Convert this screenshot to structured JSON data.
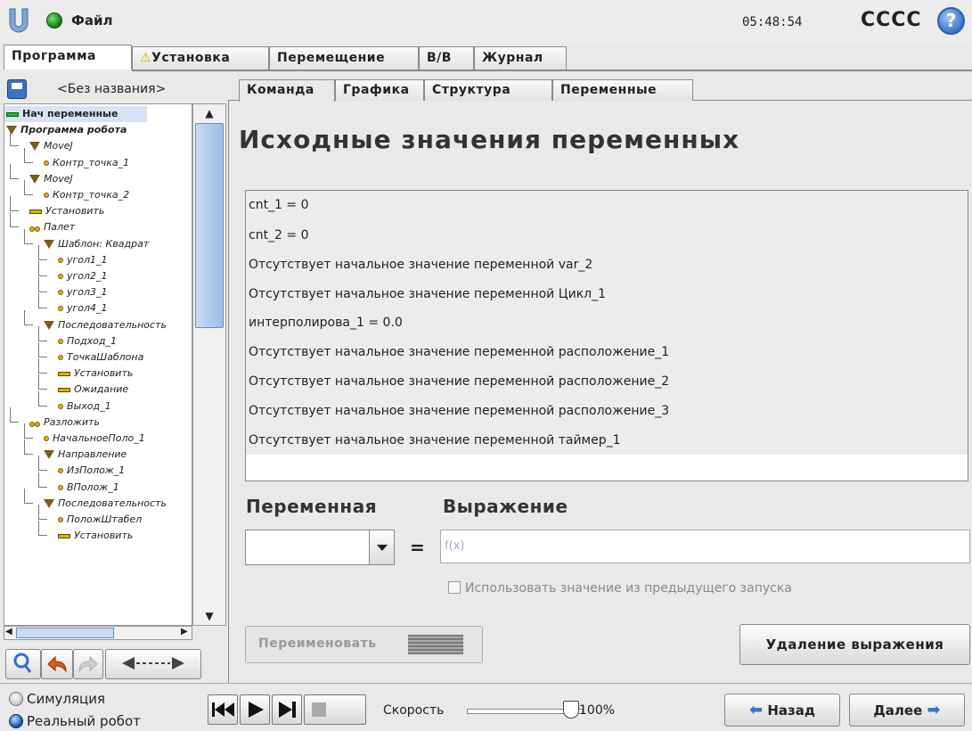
{
  "header": {
    "file_menu": "Файл",
    "clock": "05:48:54",
    "robot_name": "CCCC",
    "help": "?"
  },
  "main_tabs": [
    {
      "label": "Программа",
      "active": true
    },
    {
      "label": "Установка",
      "warning": true
    },
    {
      "label": "Перемещение"
    },
    {
      "label": "В/В"
    },
    {
      "label": "Журнал"
    }
  ],
  "program": {
    "name": "<Без названия>"
  },
  "tree": [
    {
      "label": "Нач переменные",
      "icon": "green-bar",
      "depth": 0,
      "highlight": true
    },
    {
      "label": "Программа робота",
      "icon": "triangle",
      "depth": 0,
      "bold": true
    },
    {
      "label": "MoveJ",
      "icon": "triangle",
      "depth": 1
    },
    {
      "label": "Контр_точка_1",
      "icon": "waypoint",
      "depth": 2
    },
    {
      "label": "MoveJ",
      "icon": "triangle",
      "depth": 1
    },
    {
      "label": "Контр_точка_2",
      "icon": "waypoint",
      "depth": 2
    },
    {
      "label": "Установить",
      "icon": "bar",
      "depth": 1
    },
    {
      "label": "Палет",
      "icon": "pallet",
      "depth": 1
    },
    {
      "label": "Шаблон: Квадрат",
      "icon": "triangle",
      "depth": 2
    },
    {
      "label": "угол1_1",
      "icon": "waypoint",
      "depth": 3
    },
    {
      "label": "угол2_1",
      "icon": "waypoint",
      "depth": 3
    },
    {
      "label": "угол3_1",
      "icon": "waypoint",
      "depth": 3
    },
    {
      "label": "угол4_1",
      "icon": "waypoint",
      "depth": 3
    },
    {
      "label": "Последовательность",
      "icon": "triangle",
      "depth": 2
    },
    {
      "label": "Подход_1",
      "icon": "waypoint",
      "depth": 3
    },
    {
      "label": "ТочкаШаблона",
      "icon": "waypoint",
      "depth": 3
    },
    {
      "label": "Установить",
      "icon": "bar",
      "depth": 3
    },
    {
      "label": "Ожидание",
      "icon": "bar",
      "depth": 3
    },
    {
      "label": "Выход_1",
      "icon": "waypoint",
      "depth": 3
    },
    {
      "label": "Разложить",
      "icon": "pallet",
      "depth": 1
    },
    {
      "label": "НачальноеПоло_1",
      "icon": "waypoint",
      "depth": 2
    },
    {
      "label": "Направление",
      "icon": "triangle",
      "depth": 2
    },
    {
      "label": "ИзПолож_1",
      "icon": "waypoint",
      "depth": 3
    },
    {
      "label": "ВПолож_1",
      "icon": "waypoint",
      "depth": 3
    },
    {
      "label": "Последовательность",
      "icon": "triangle",
      "depth": 2
    },
    {
      "label": "ПоложШтабел",
      "icon": "waypoint",
      "depth": 3
    },
    {
      "label": "Установить",
      "icon": "bar",
      "depth": 3
    }
  ],
  "sub_tabs": [
    {
      "label": "Команда",
      "active": true
    },
    {
      "label": "Графика"
    },
    {
      "label": "Структура"
    },
    {
      "label": "Переменные"
    }
  ],
  "page": {
    "title": "Исходные значения переменных",
    "variables": [
      "cnt_1 = 0",
      "cnt_2 = 0",
      "Отсутствует начальное значение переменной var_2",
      "Отсутствует начальное значение переменной Цикл_1",
      "интерполирова_1 = 0.0",
      "Отсутствует начальное значение переменной расположение_1",
      "Отсутствует начальное значение переменной расположение_2",
      "Отсутствует начальное значение переменной расположение_3",
      "Отсутствует начальное значение переменной таймер_1"
    ],
    "variable_label": "Переменная",
    "expression_label": "Выражение",
    "equals": "=",
    "expression_placeholder": "f(x)",
    "use_previous_label": "Использовать значение из предыдущего запуска",
    "use_previous_checked": false,
    "rename_button": "Переименовать",
    "delete_button": "Удаление выражения"
  },
  "footer": {
    "simulation_label": "Симуляция",
    "real_robot_label": "Реальный робот",
    "real_robot_selected": true,
    "speed_label": "Скорость",
    "speed_value": "100%",
    "speed_fraction": 1.0,
    "back_button": "Назад",
    "next_button": "Далее"
  },
  "colors": {
    "accent": "#3b74c4",
    "status_ok": "#1b8a1b",
    "highlight": "#d7e3f3",
    "warning": "#e0b000"
  }
}
